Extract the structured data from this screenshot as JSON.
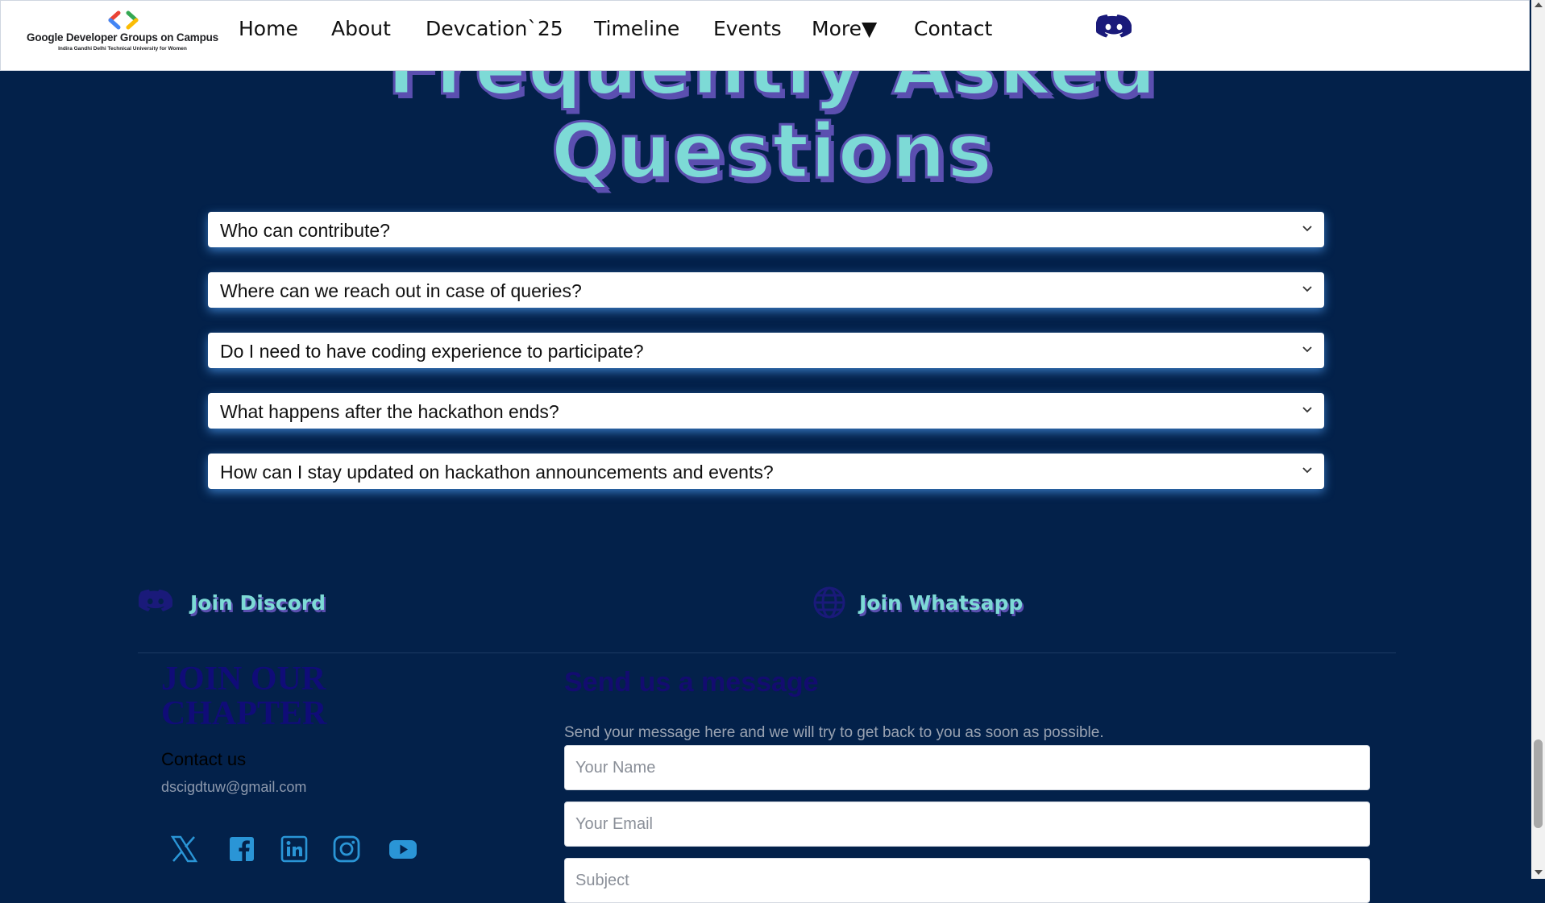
{
  "navbar": {
    "logo_title": "Google Developer Groups on Campus",
    "logo_subtitle": "Indira Gandhi Delhi Technical University for Women",
    "links": [
      "Home",
      "About",
      "Devcation`25",
      "Timeline",
      "Events",
      "More▼",
      "Contact"
    ],
    "discord_icon": "discord-icon"
  },
  "faq": {
    "title_line1": "Frequently Asked",
    "title_line2": "Questions",
    "questions": [
      "Who can contribute?",
      "Where can we reach out in case of queries?",
      "Do I need to have coding experience to participate?",
      "What happens after the hackathon ends?",
      "How can I stay updated on hackathon announcements and events?"
    ]
  },
  "join": {
    "discord_label": "Join Discord",
    "whatsapp_label": "Join Whatsapp"
  },
  "footer": {
    "chapter_title": "JOIN OUR CHAPTER",
    "contact_label": "Contact us",
    "email": "dscigdtuw@gmail.com",
    "socials": [
      "x-icon",
      "facebook-icon",
      "linkedin-icon",
      "instagram-icon",
      "youtube-icon"
    ]
  },
  "form": {
    "title": "Send us a message",
    "description": "Send your message here and we will try to get back to you as soon as possible.",
    "name_placeholder": "Your Name",
    "email_placeholder": "Your Email",
    "subject_placeholder": "Subject"
  },
  "colors": {
    "background": "#03214a",
    "accent_teal": "#7ddad6",
    "accent_purple": "#5b4fb0",
    "icon_navy": "#1a1a7a"
  }
}
